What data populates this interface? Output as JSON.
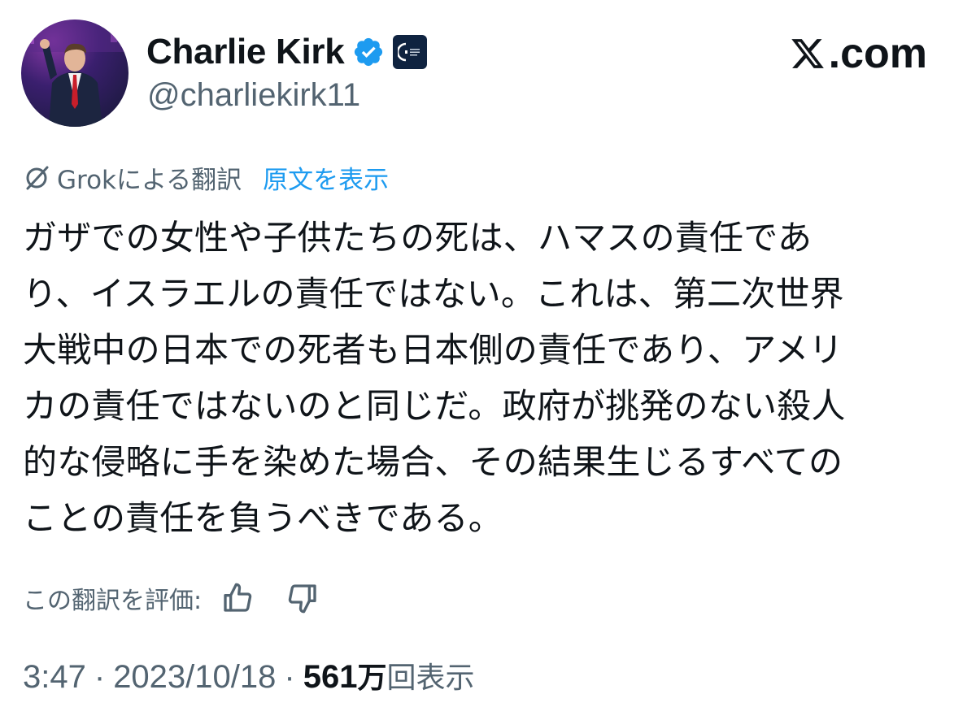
{
  "author": {
    "display_name": "Charlie Kirk",
    "handle": "@charliekirk11",
    "verified_icon": "verified-badge-icon",
    "affiliate_icon": "organization-affiliate-icon",
    "avatar_icon": "profile-photo"
  },
  "site": {
    "logo_text": ".com",
    "logo_icon": "x-logo-icon"
  },
  "translation": {
    "icon": "grok-icon",
    "label": "Grokによる翻訳",
    "show_original": "原文を表示"
  },
  "tweet": {
    "text": "ガザでの女性や子供たちの死は、ハマスの責任であ\nり、イスラエルの責任ではない。これは、第二次世界\n大戦中の日本での死者も日本側の責任であり、アメリ\nカの責任ではないのと同じだ。政府が挑発のない殺人\n的な侵略に手を染めた場合、その結果生じるすべての\nことの責任を負うべきである。"
  },
  "rating": {
    "label": "この翻訳を評価:",
    "thumbs_up_icon": "thumbs-up-icon",
    "thumbs_down_icon": "thumbs-down-icon"
  },
  "meta": {
    "time": "3:47",
    "separator": "·",
    "date": "2023/10/18",
    "views_count": "561",
    "views_unit": "万",
    "views_label": "回表示"
  },
  "colors": {
    "text_primary": "#0f1419",
    "text_secondary": "#536471",
    "link": "#1d9bf0",
    "verified": "#1d9bf0"
  }
}
